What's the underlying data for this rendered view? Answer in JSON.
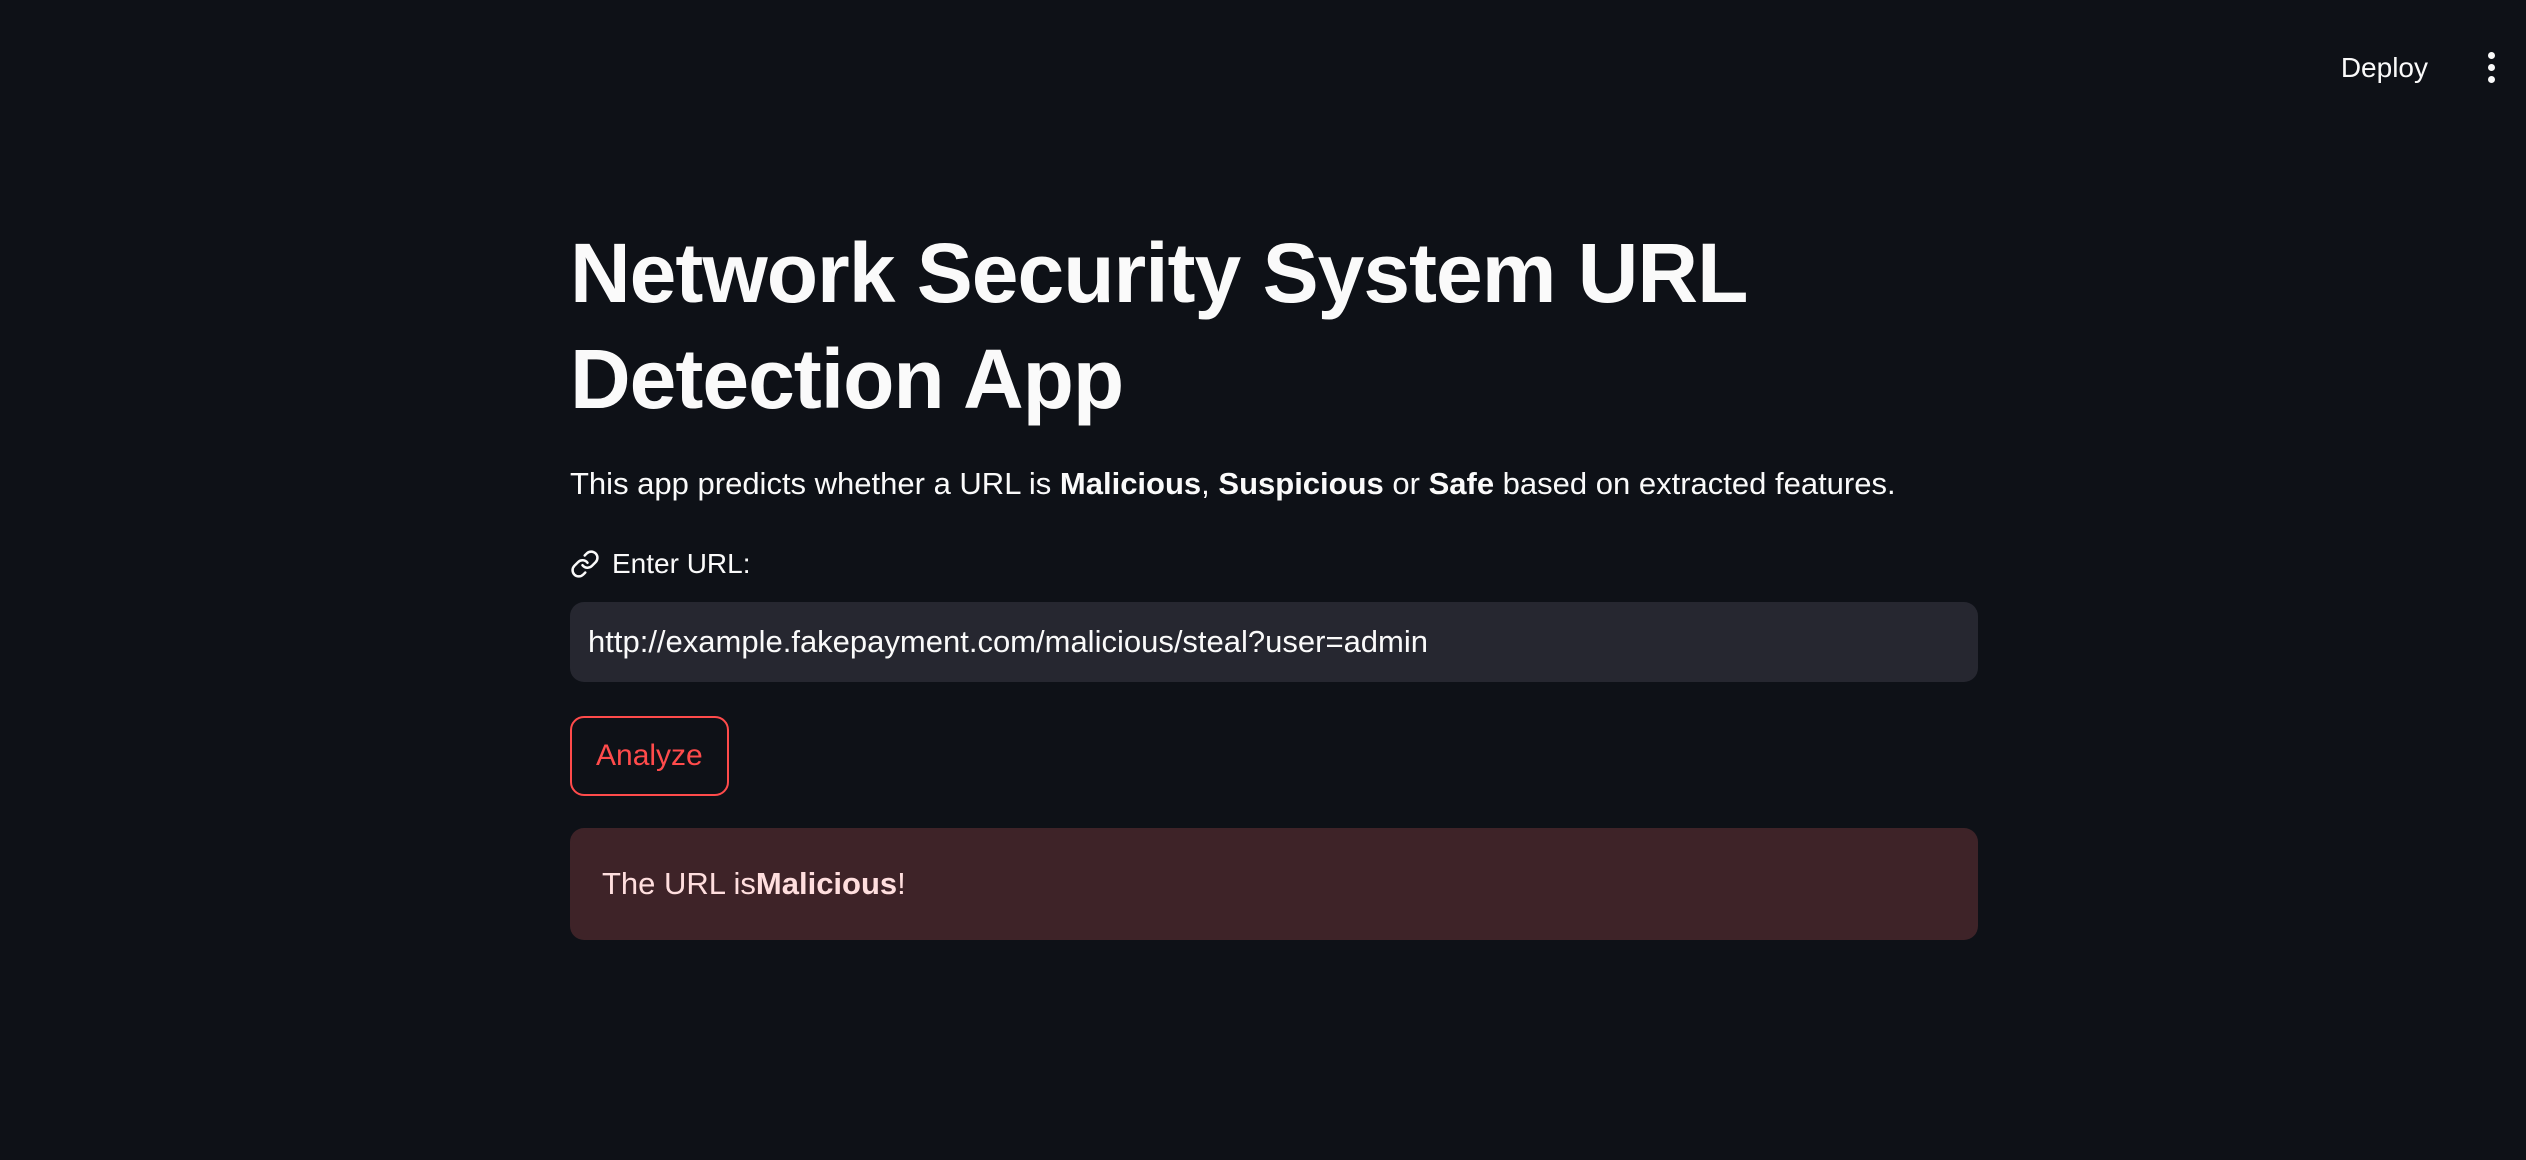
{
  "header": {
    "deploy_label": "Deploy",
    "menu_icon": "vertical-ellipsis-icon"
  },
  "main": {
    "title": "Network Security System URL Detection App",
    "description": {
      "prefix": "This app predicts whether a URL is ",
      "malicious": "Malicious",
      "sep1": ", ",
      "suspicious": "Suspicious",
      "sep2": " or ",
      "safe": "Safe",
      "suffix": " based on extracted features."
    },
    "url_field": {
      "icon": "link-icon",
      "label": "Enter URL:",
      "value": "http://example.fakepayment.com/malicious/steal?user=admin",
      "placeholder": ""
    },
    "analyze_button": {
      "label": "Analyze"
    },
    "result": {
      "prefix": "The URL is ",
      "verdict": "Malicious",
      "suffix": "!"
    }
  },
  "colors": {
    "background": "#0e1117",
    "text": "#fafafa",
    "input_background": "#262730",
    "accent": "#ff4b4b",
    "alert_background": "#3e2428",
    "alert_text": "#ffdede"
  }
}
